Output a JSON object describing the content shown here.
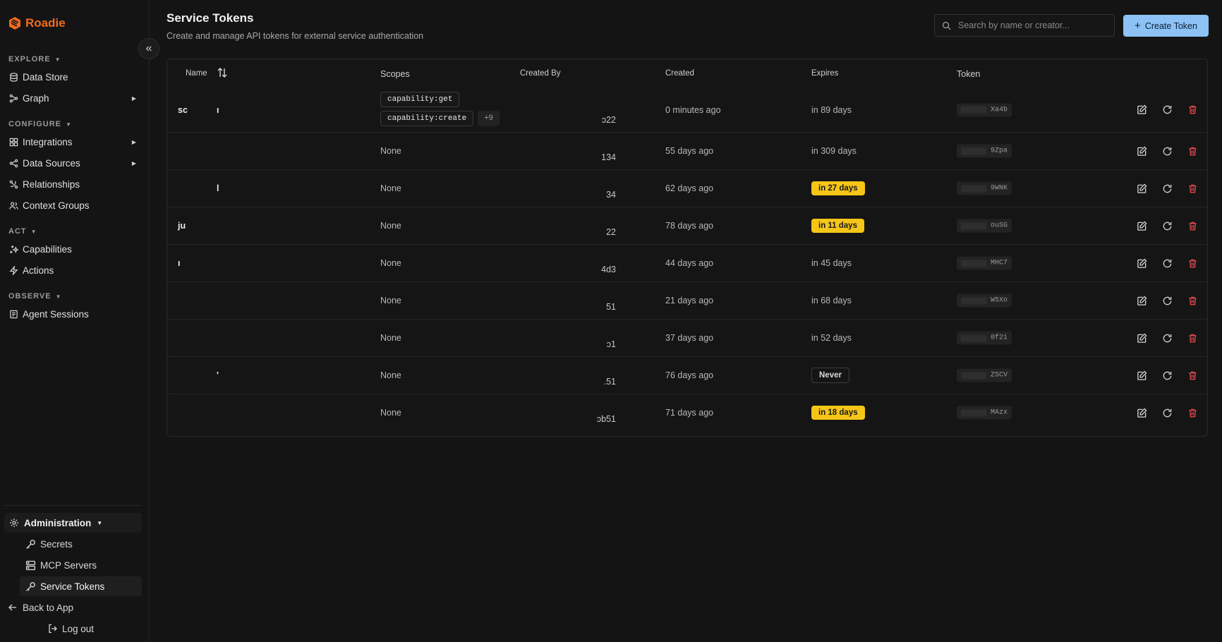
{
  "brand": {
    "name": "Roadie",
    "accent": "#f26b1d"
  },
  "sidebar": {
    "sections": [
      {
        "label": "EXPLORE",
        "items": [
          {
            "label": "Data Store",
            "icon": "database-icon"
          },
          {
            "label": "Graph",
            "icon": "graph-icon",
            "expandable": true
          }
        ]
      },
      {
        "label": "CONFIGURE",
        "items": [
          {
            "label": "Integrations",
            "icon": "puzzle-icon",
            "expandable": true
          },
          {
            "label": "Data Sources",
            "icon": "share-icon",
            "expandable": true
          },
          {
            "label": "Relationships",
            "icon": "relationship-icon"
          },
          {
            "label": "Context Groups",
            "icon": "users-icon"
          }
        ]
      },
      {
        "label": "ACT",
        "items": [
          {
            "label": "Capabilities",
            "icon": "sparkles-icon"
          },
          {
            "label": "Actions",
            "icon": "bolt-icon"
          }
        ]
      },
      {
        "label": "OBSERVE",
        "items": [
          {
            "label": "Agent Sessions",
            "icon": "history-icon"
          }
        ]
      }
    ],
    "admin": {
      "label": "Administration",
      "items": [
        {
          "label": "Secrets"
        },
        {
          "label": "MCP Servers"
        },
        {
          "label": "Service Tokens",
          "active": true
        }
      ]
    },
    "back_label": "Back to App",
    "logout_label": "Log out"
  },
  "header": {
    "title": "Service Tokens",
    "subtitle": "Create and manage API tokens for external service authentication",
    "search_placeholder": "Search by name or creator...",
    "create_label": "Create Token"
  },
  "table": {
    "columns": {
      "name": "Name",
      "scopes": "Scopes",
      "created_by": "Created By",
      "created": "Created",
      "expires": "Expires",
      "token": "Token"
    },
    "rows": [
      {
        "name": "sc",
        "name_tail": "ı",
        "scopes": [
          "capability:get",
          "capability:create"
        ],
        "more": "+9",
        "created_by": "ɔ22",
        "created": "0 minutes ago",
        "expires": "in 89 days",
        "expires_style": "plain",
        "token": "Xa4b"
      },
      {
        "name": "",
        "scopes_text": "None",
        "created_by": "134",
        "created": "55 days ago",
        "expires": "in 309 days",
        "expires_style": "plain",
        "token": "9Zpa"
      },
      {
        "name": "",
        "name_tail": "l",
        "scopes_text": "None",
        "created_by": "34",
        "created": "62 days ago",
        "expires": "in 27 days",
        "expires_style": "yellow",
        "token": "9WNK"
      },
      {
        "name": "ju",
        "scopes_text": "None",
        "created_by": "22",
        "created": "78 days ago",
        "expires": "in 11 days",
        "expires_style": "yellow",
        "token": "ouSG"
      },
      {
        "name": "ı",
        "scopes_text": "None",
        "created_by": "4d3",
        "created": "44 days ago",
        "expires": "in 45 days",
        "expires_style": "plain",
        "token": "MHC7"
      },
      {
        "name": "",
        "scopes_text": "None",
        "created_by": "51",
        "created": "21 days ago",
        "expires": "in 68 days",
        "expires_style": "plain",
        "token": "W5Xo"
      },
      {
        "name": "",
        "scopes_text": "None",
        "created_by": "ɔ1",
        "created": "37 days ago",
        "expires": "in 52 days",
        "expires_style": "plain",
        "token": "0f2i"
      },
      {
        "name": "",
        "name_tail": "'",
        "scopes_text": "None",
        "created_by": ".51",
        "created": "76 days ago",
        "expires": "Never",
        "expires_style": "outline",
        "token": "ZSCV"
      },
      {
        "name": "",
        "scopes_text": "None",
        "created_by": "ɔb51",
        "created": "71 days ago",
        "expires": "in 18 days",
        "expires_style": "yellow",
        "token": "MAzx"
      }
    ]
  },
  "colors": {
    "primary_button": "#8cc2f5",
    "warning": "#f5c518",
    "danger": "#e5484d"
  }
}
